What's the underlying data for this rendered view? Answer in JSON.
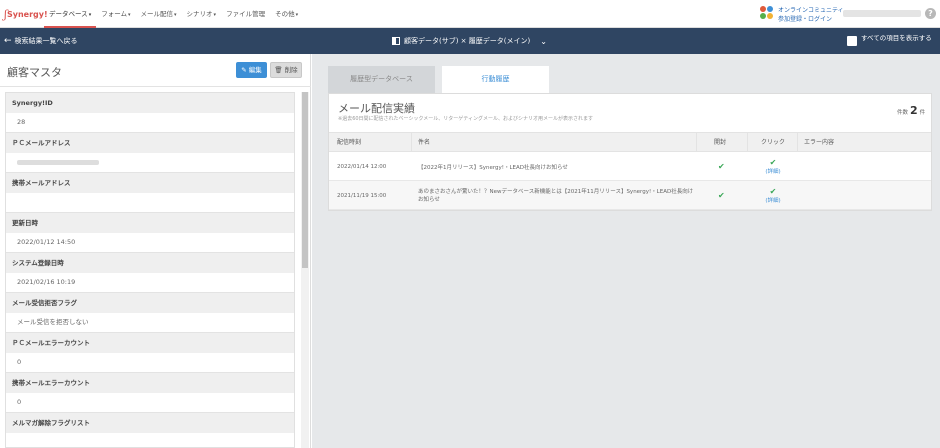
{
  "topnav": {
    "logo_text": "Synergy!",
    "menu": [
      {
        "label": "データベース",
        "caret": "▾",
        "active": true
      },
      {
        "label": "フォーム",
        "caret": "▾"
      },
      {
        "label": "メール配信",
        "caret": "▾"
      },
      {
        "label": "シナリオ",
        "caret": "▾"
      },
      {
        "label": "ファイル管理",
        "caret": ""
      },
      {
        "label": "その他",
        "caret": "▾"
      }
    ],
    "community_line1": "オンラインコミュニティ",
    "community_line2": "参加登録・ログイン",
    "help": "?"
  },
  "darkbar": {
    "back_label": "検索結果一覧へ戻る",
    "db_select": "顧客データ(サブ) × 履歴データ(メイン)",
    "show_all": "すべての項目を表示する"
  },
  "left": {
    "title": "顧客マスタ",
    "edit_label": "編集",
    "delete_label": "削除",
    "fields": [
      {
        "label": "Synergy!ID",
        "value": "28"
      },
      {
        "label": "ＰＣメールアドレス",
        "value": ""
      },
      {
        "label": "携帯メールアドレス",
        "value": ""
      },
      {
        "label": "更新日時",
        "value": "2022/01/12 14:50"
      },
      {
        "label": "システム登録日時",
        "value": "2021/02/16 10:19"
      },
      {
        "label": "メール受信拒否フラグ",
        "value": "メール受信を拒否しない"
      },
      {
        "label": "ＰＣメールエラーカウント",
        "value": "0"
      },
      {
        "label": "携帯メールエラーカウント",
        "value": "0"
      },
      {
        "label": "メルマガ解除フラグリスト",
        "value": ""
      }
    ]
  },
  "right": {
    "tab1": "履歴型データベース",
    "tab2": "行動履歴",
    "card_title": "メール配信実績",
    "card_sub": "※過去60日間に配信されたベーシックメール、リターゲティングメール、およびシナリオ用メールが表示されます",
    "count_prefix": "件数",
    "count": "2",
    "count_suffix": "件",
    "columns": [
      "配信時刻",
      "件名",
      "開封",
      "クリック",
      "エラー内容"
    ],
    "rows": [
      {
        "time": "2022/01/14 12:00",
        "subject": "【2022年1月リリース】Synergy!・LEAD社長向けお知らせ",
        "open": "✔",
        "click": "✔",
        "detail": "(詳細)",
        "error": ""
      },
      {
        "time": "2021/11/19 15:00",
        "subject": "あのまさおさんが驚いた！？Newデータベース新機能とは【2021年11月リリース】Synergy!・LEAD社長向けお知らせ",
        "open": "✔",
        "click": "✔",
        "detail": "(詳細)",
        "error": ""
      }
    ]
  }
}
